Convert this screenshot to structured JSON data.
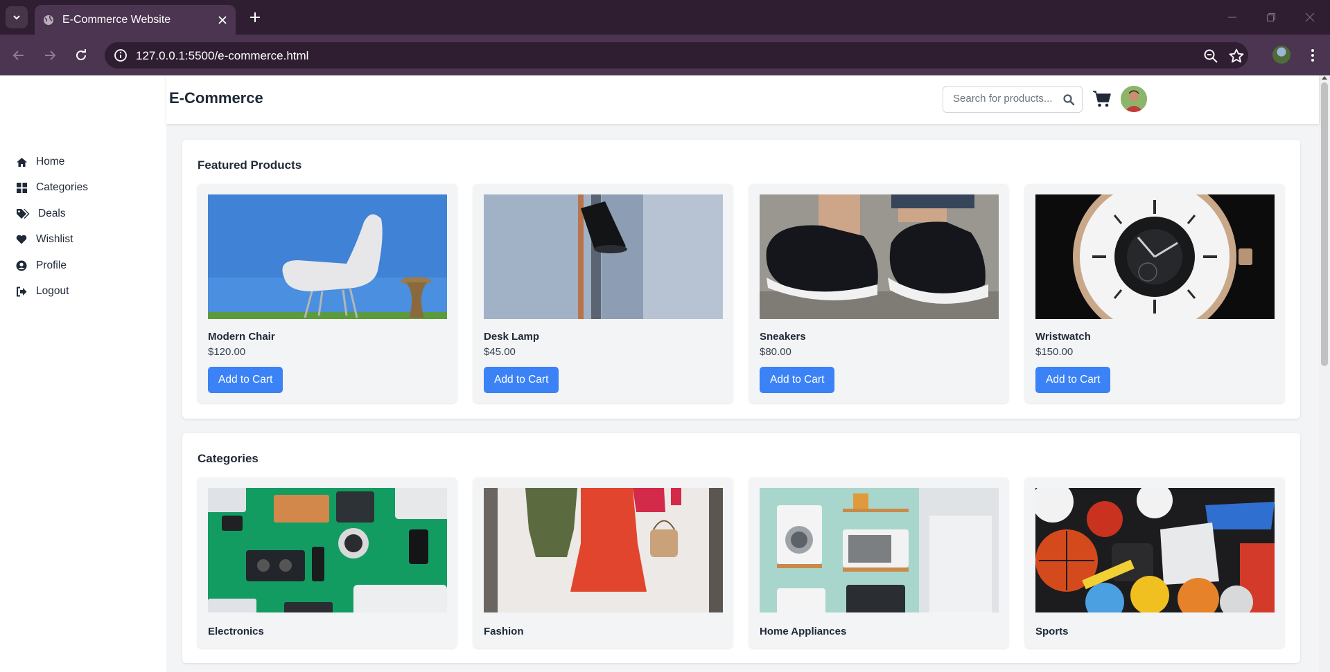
{
  "browser": {
    "tab_title": "E-Commerce Website",
    "url": "127.0.0.1:5500/e-commerce.html"
  },
  "header": {
    "brand": "E-Commerce",
    "search_placeholder": "Search for products..."
  },
  "sidebar": {
    "items": [
      {
        "label": "Home",
        "icon": "home-icon"
      },
      {
        "label": "Categories",
        "icon": "grid-icon"
      },
      {
        "label": "Deals",
        "icon": "tags-icon"
      },
      {
        "label": "Wishlist",
        "icon": "heart-icon"
      },
      {
        "label": "Profile",
        "icon": "user-circle-icon"
      },
      {
        "label": "Logout",
        "icon": "sign-out-icon"
      }
    ]
  },
  "featured": {
    "title": "Featured Products",
    "products": [
      {
        "name": "Modern Chair",
        "price": "$120.00",
        "button": "Add to Cart"
      },
      {
        "name": "Desk Lamp",
        "price": "$45.00",
        "button": "Add to Cart"
      },
      {
        "name": "Sneakers",
        "price": "$80.00",
        "button": "Add to Cart"
      },
      {
        "name": "Wristwatch",
        "price": "$150.00",
        "button": "Add to Cart"
      }
    ]
  },
  "categories": {
    "title": "Categories",
    "items": [
      {
        "name": "Electronics"
      },
      {
        "name": "Fashion"
      },
      {
        "name": "Home Appliances"
      },
      {
        "name": "Sports"
      }
    ]
  },
  "colors": {
    "accent": "#3b82f6",
    "browser_frame": "#2f1e31",
    "page_bg": "#f3f4f6"
  }
}
